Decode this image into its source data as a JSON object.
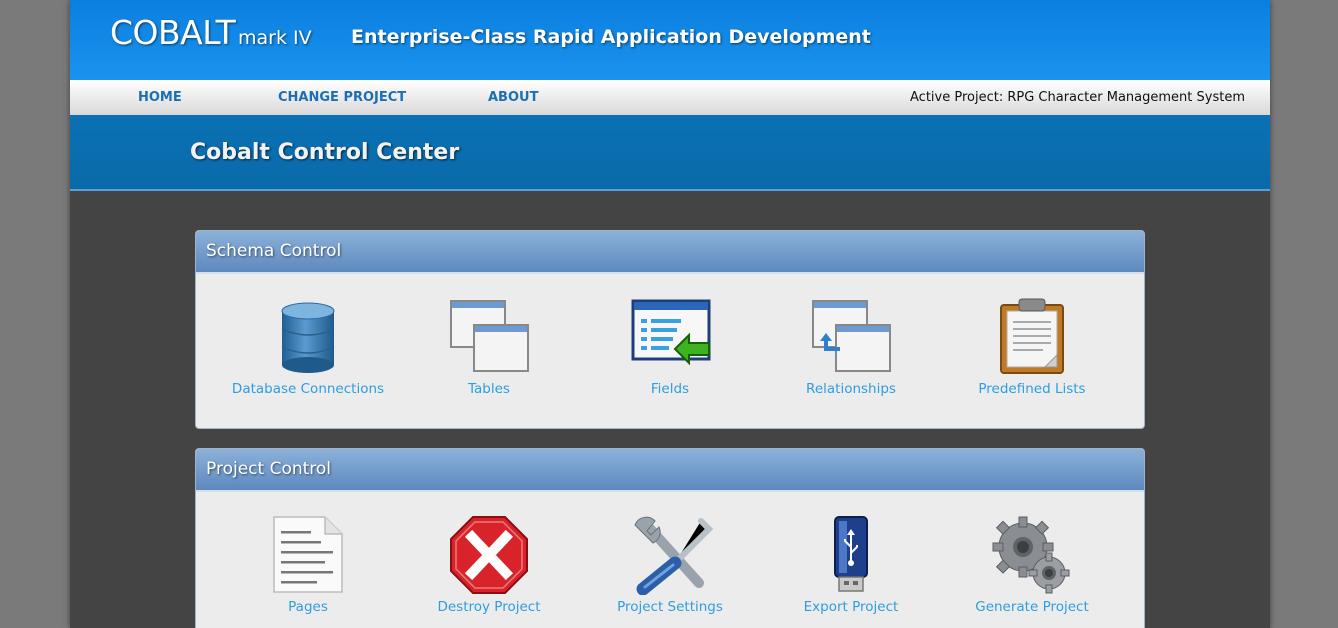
{
  "header": {
    "logo_main": "COBALT",
    "logo_sub": "mark IV",
    "tagline": "Enterprise-Class Rapid Application Development"
  },
  "nav": {
    "items": [
      {
        "label": "HOME"
      },
      {
        "label": "CHANGE PROJECT"
      },
      {
        "label": "ABOUT"
      }
    ],
    "active_project": "Active Project: RPG Character Management System"
  },
  "page_title": "Cobalt Control Center",
  "panels": [
    {
      "title": "Schema Control",
      "items": [
        {
          "label": "Database Connections",
          "icon": "database-icon"
        },
        {
          "label": "Tables",
          "icon": "tables-icon"
        },
        {
          "label": "Fields",
          "icon": "fields-icon"
        },
        {
          "label": "Relationships",
          "icon": "relationships-icon"
        },
        {
          "label": "Predefined Lists",
          "icon": "clipboard-icon"
        }
      ]
    },
    {
      "title": "Project Control",
      "items": [
        {
          "label": "Pages",
          "icon": "page-icon"
        },
        {
          "label": "Destroy Project",
          "icon": "stop-x-icon"
        },
        {
          "label": "Project Settings",
          "icon": "wrench-screwdriver-icon"
        },
        {
          "label": "Export Project",
          "icon": "usb-drive-icon"
        },
        {
          "label": "Generate Project",
          "icon": "gears-icon"
        }
      ]
    }
  ],
  "colors": {
    "header_blue": "#0b7fe0",
    "title_band_blue": "#0a71b4",
    "link_blue": "#2e9de2",
    "nav_link": "#1c6fb5",
    "page_bg": "#444444"
  }
}
